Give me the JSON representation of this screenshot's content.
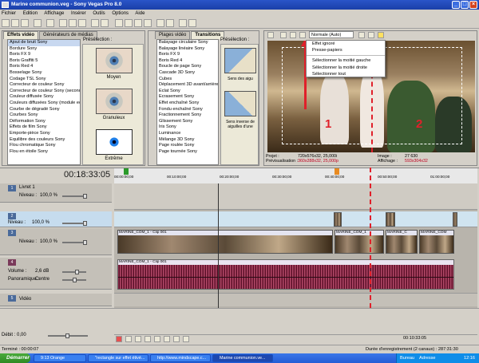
{
  "window": {
    "title": "Marine communion.veg - Sony Vegas Pro 8.0"
  },
  "menu": [
    "Fichier",
    "Edition",
    "Affichage",
    "Insérer",
    "Outils",
    "Options",
    "Aide"
  ],
  "effects_panel": {
    "tabs": [
      "Effets vidéo",
      "Générateurs de médias"
    ],
    "preview_label": "Présélection :",
    "items": [
      "Ajout de bruit Sony",
      "Bordure Sony",
      "Boris FX 9",
      "Boris Graffiti 5",
      "Boris Red 4",
      "Bosselage Sony",
      "Codage TSL Sony",
      "Correcteur de couleur Sony",
      "Correcteur de couleur Sony (seconda",
      "Couleur diffusée Sony",
      "Couleurs diffusées Sony (module ech",
      "Courbe de dégradé Sony",
      "Courbes Sony",
      "Déformation Sony",
      "Effets de film Sony",
      "Emporte-pièce Sony",
      "Equilibre des couleurs Sony",
      "Flou chromatique Sony",
      "Flou en étoile Sony"
    ],
    "presets": [
      "Moyen",
      "Granuleux",
      "Extrême"
    ]
  },
  "transitions_panel": {
    "tabs": [
      "Plages vidéo",
      "Transitions"
    ],
    "preview_label": "Présélection :",
    "items": [
      "Balayage circulaire Sony",
      "Balayage linéaire Sony",
      "Boris FX 9",
      "Boris Red 4",
      "Boucle de page Sony",
      "Cascade 3D Sony",
      "Cubes",
      "Déplacement 3D avant/arrière",
      "Éclat Sony",
      "Écrasement Sony",
      "Effet enchaîné Sony",
      "Fondu enchaîné Sony",
      "Fractionnement Sony",
      "Glissement Sony",
      "Iris Sony",
      "Luminance",
      "Mélange 3D Sony",
      "Page roulée Sony",
      "Page tournée Sony"
    ],
    "preset_captions": [
      "Sens des aigu",
      "Sens inverse de aiguilles d'une"
    ]
  },
  "viewer": {
    "quality": "Normale (Auto)",
    "context_menu": [
      "Effet ignoré",
      "Presse-papiers",
      "Sélectionner la moitié gauche",
      "Sélectionner la moitié droite",
      "Sélectionner tout"
    ],
    "project_label": "Projet :",
    "project_value": "720x576x32, 25,000i",
    "preview_label": "Prévisualisation :",
    "preview_value": "360x288x32, 25,000p",
    "image_label": "Image :",
    "image_value": "27 630",
    "display_label": "Affichage :",
    "display_value": "593x304x32",
    "marker1": "1",
    "marker2": "2"
  },
  "timeline": {
    "timecode": "00:18:33:05",
    "ruler": [
      "00:00:00;00",
      "00:10:00;00",
      "00:20:00;00",
      "00:30:00;00",
      "00:40:00;00",
      "00:50:00;00",
      "01:00:00;00"
    ],
    "tracks": [
      {
        "name": "Livret 1",
        "level_label": "Niveau :",
        "level_value": "100,0 %"
      },
      {
        "name": "",
        "level_label": "Niveau :",
        "level_value": "100,0 %"
      },
      {
        "name": "",
        "level_label": "Niveau :",
        "level_value": "100,0 %"
      },
      {
        "name": "",
        "volume_label": "Volume :",
        "volume_value": "2,6 dB",
        "pan_label": "Panoramique :",
        "pan_value": "Centre"
      },
      {
        "name": "Vidéo",
        "level_label": "",
        "level_value": ""
      }
    ],
    "clips": [
      "MARINE_COM_1 - Clip 001",
      "MARINE_COM_1",
      "MARINE_C",
      "MARINE_COM"
    ],
    "audio_clip": "MARINE_COM_1 - Clip 001",
    "rate_label": "Débit : 0,00",
    "end_time": "00:10:33:05"
  },
  "status": {
    "left": "Terminé : 00:00:07",
    "right": "Durée d'enregistrement (2 canaux) : 287:31:30"
  },
  "taskbar": {
    "start": "Démarrer",
    "tasks": [
      "9:13 Orange",
      "\"rectangle sur effet étivé...",
      "http://www.mindscape.c...",
      "Marine communion.ve..."
    ],
    "tray_bureau": "Bureau",
    "tray_adresse": "Adresse",
    "clock": "12:16"
  }
}
